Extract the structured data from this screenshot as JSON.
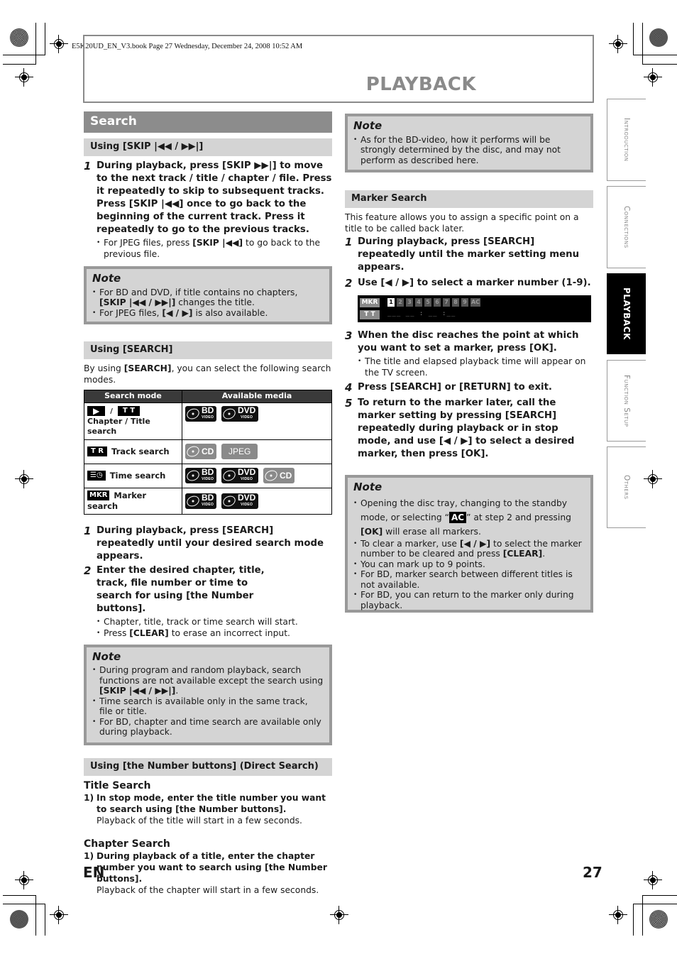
{
  "file_info": "E5K20UD_EN_V3.book  Page 27  Wednesday, December 24, 2008  10:52 AM",
  "header": {
    "title": "PLAYBACK"
  },
  "side_tabs": [
    {
      "label": "Introduction",
      "active": false
    },
    {
      "label": "Connections",
      "active": false
    },
    {
      "label": "PLAYBACK",
      "active": true
    },
    {
      "label": "Function Setup",
      "active": false
    },
    {
      "label": "Others",
      "active": false
    }
  ],
  "left": {
    "section_title": "Search",
    "skip": {
      "title": "Using [SKIP |◀◀ / ▶▶|]",
      "step1_num": "1",
      "step1": "During playback, press [SKIP ▶▶|] to move to the next track / title / chapter / file. Press it repeatedly to skip to subsequent tracks. Press [SKIP |◀◀] once to go back to the beginning of the current track. Press it repeatedly to go to the previous tracks.",
      "bullet1_pre": "For JPEG files, press ",
      "bullet1_bold": "[SKIP |◀◀]",
      "bullet1_post": " to go back to the previous file.",
      "note": {
        "title": "Note",
        "item1_pre": "For BD and DVD, if title contains no chapters, ",
        "item1_bold": "[SKIP |◀◀ / ▶▶|]",
        "item1_post": " changes the title.",
        "item2_pre": "For JPEG files, ",
        "item2_bold": "[◀ / ▶]",
        "item2_post": " is also available."
      }
    },
    "search": {
      "title": "Using [SEARCH]",
      "intro_pre": "By using ",
      "intro_bold": "[SEARCH]",
      "intro_post": ", you can select the following search modes.",
      "table": {
        "headers": [
          "Search mode",
          "Available media"
        ],
        "rows": [
          {
            "icons": [
              "▶",
              "T T"
            ],
            "separator": "/",
            "label": "Chapter / Title search",
            "media": [
              "BD",
              "DVD"
            ]
          },
          {
            "icons": [
              "T R"
            ],
            "label": "Track search",
            "media": [
              "CD",
              "JPEG"
            ]
          },
          {
            "icons": [
              "time-icon"
            ],
            "label": "Time search",
            "media": [
              "BD",
              "DVD",
              "CD"
            ]
          },
          {
            "icons": [
              "MKR"
            ],
            "label": "Marker search",
            "media": [
              "BD",
              "DVD"
            ]
          }
        ],
        "media_sub": "VIDEO"
      },
      "step1_num": "1",
      "step1": "During playback, press [SEARCH] repeatedly until your desired search mode appears.",
      "step2_num": "2",
      "step2": "Enter the desired chapter, title, track, file number or time to search for using [the Number buttons].",
      "bullet1": "Chapter, title, track or time search will start.",
      "bullet2_pre": "Press ",
      "bullet2_bold": "[CLEAR]",
      "bullet2_post": " to erase an incorrect input.",
      "note": {
        "title": "Note",
        "item1_pre": "During program and random playback, search functions are not available except the search using ",
        "item1_bold": "[SKIP |◀◀ / ▶▶|]",
        "item1_post": ".",
        "item2": "Time search is available only in the same track, file or title.",
        "item3": "For BD, chapter and time search are available only during playback."
      }
    },
    "direct": {
      "title": "Using [the Number buttons] (Direct Search)",
      "title_search": {
        "heading": "Title Search",
        "num": "1)",
        "step": "In stop mode, enter the title number you want to search using [the Number buttons].",
        "result": "Playback of the title will start in a few seconds."
      },
      "chapter_search": {
        "heading": "Chapter Search",
        "num": "1)",
        "step": "During playback of a title, enter the chapter number you want to search using [the Number buttons].",
        "result": "Playback of the chapter will start in a few seconds."
      }
    }
  },
  "right": {
    "note_top": {
      "title": "Note",
      "item1": "As for the BD-video, how it performs will be strongly determined by the disc, and may not perform as described here."
    },
    "marker": {
      "title": "Marker Search",
      "intro": "This feature allows you to assign a specific point on a title to be called back later.",
      "step1_num": "1",
      "step1": "During playback, press [SEARCH] repeatedly until the marker setting menu appears.",
      "step2_num": "2",
      "step2": "Use [◀ / ▶] to select a marker number (1-9).",
      "osd": {
        "mkr_label": "MKR",
        "tt_label": "T T",
        "numbers": [
          "1",
          "2",
          "3",
          "4",
          "5",
          "6",
          "7",
          "8",
          "9",
          "AC"
        ],
        "selected": "1",
        "time": "___  __ : __ :__"
      },
      "step3_num": "3",
      "step3": "When the disc reaches the point at which you want to set a marker, press [OK].",
      "step3_bullet": "The title and elapsed playback time will appear on the TV screen.",
      "step4_num": "4",
      "step4": "Press [SEARCH] or [RETURN] to exit.",
      "step5_num": "5",
      "step5": "To return to the marker later, call the marker setting by pressing [SEARCH] repeatedly during playback or in stop mode, and use [◀ / ▶] to select a desired marker, then press [OK]."
    },
    "note_bottom": {
      "title": "Note",
      "item1_pre": "Opening the disc tray, changing to the standby mode, or selecting “",
      "item1_ac": "AC",
      "item1_mid": "” at step 2 and pressing ",
      "item1_bold": "[OK]",
      "item1_post": " will erase all markers.",
      "item2_pre": "To clear a marker, use ",
      "item2_bold1": "[◀ / ▶]",
      "item2_mid": " to select the marker number to be cleared and press ",
      "item2_bold2": "[CLEAR]",
      "item2_post": ".",
      "item3": "You can mark up to 9 points.",
      "item4": "For BD, marker search between different titles is not available.",
      "item5": "For BD, you can return to the marker only during playback."
    }
  },
  "footer": {
    "lang": "EN",
    "page": "27"
  }
}
